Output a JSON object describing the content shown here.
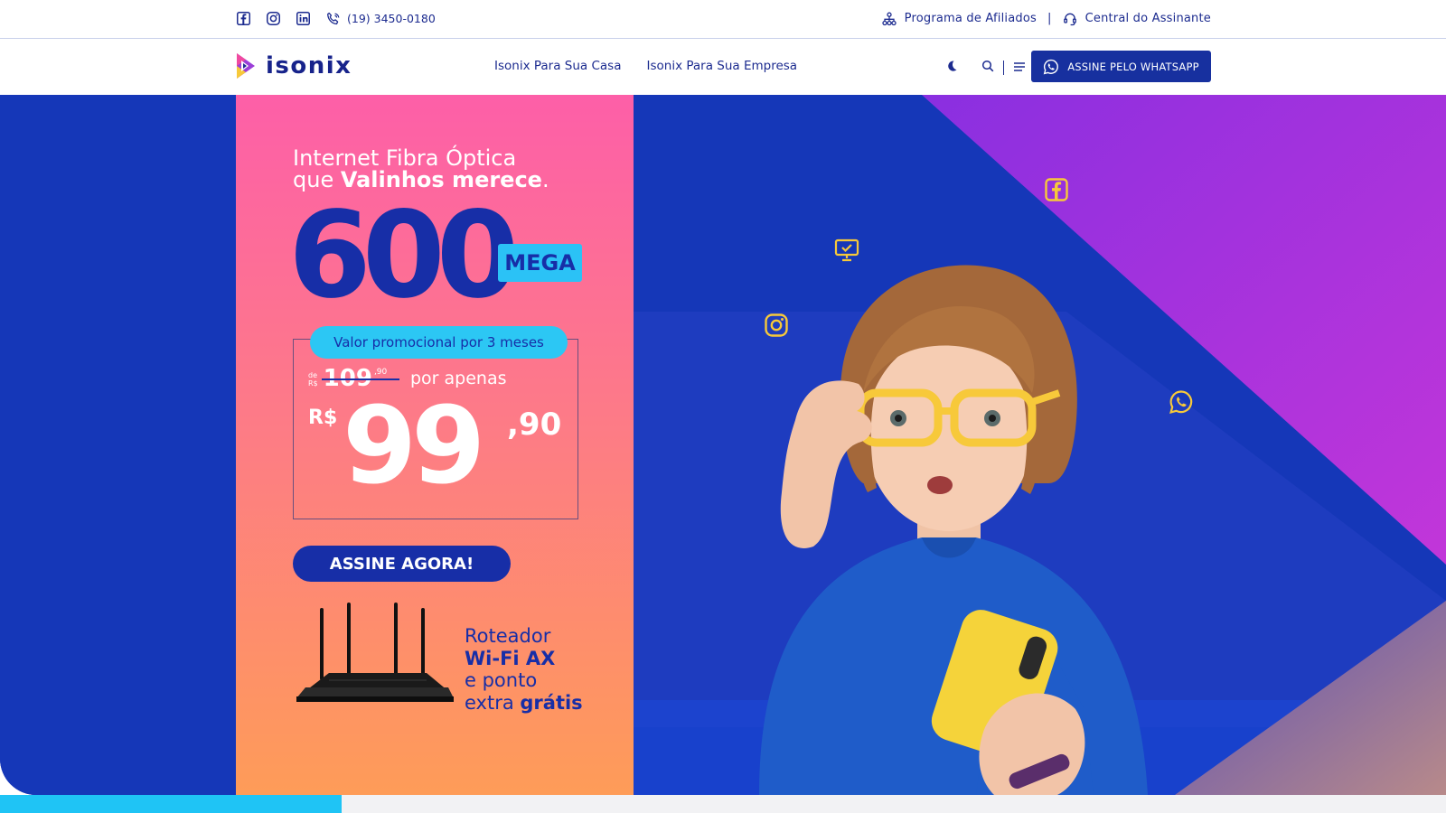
{
  "topbar": {
    "social_icons": [
      "facebook-icon",
      "instagram-icon",
      "linkedin-icon"
    ],
    "phone": "(19) 3450-0180",
    "affiliates": "Programa de Afiliados",
    "separator": "|",
    "subscriber": "Central do Assinante"
  },
  "nav": {
    "logo_text": "isonix",
    "links": [
      "Isonix Para Sua Casa",
      "Isonix Para Sua Empresa"
    ],
    "whatsapp_button": "ASSINE PELO WHATSAPP"
  },
  "hero": {
    "headline_line1": "Internet Fibra Óptica",
    "headline_line2_pre": "que ",
    "headline_line2_bold": "Valinhos merece",
    "headline_line2_post": ".",
    "speed": "600",
    "speed_unit": "MEGA",
    "promo_pill": "Valor promocional por 3 meses",
    "old_price_prefix_de": "de",
    "old_price_prefix_rs": "R$",
    "old_price": "109",
    "old_price_cents": ",90",
    "por_apenas": "por apenas",
    "currency": "R$",
    "price": "99",
    "price_cents": ",90",
    "cta": "ASSINE AGORA!",
    "router_line1": "Roteador",
    "router_line2": "Wi-Fi AX",
    "router_line3": "e ponto",
    "router_line4_pre": "extra ",
    "router_line4_bold": "grátis"
  },
  "colors": {
    "brand_blue": "#172ea7",
    "cyan": "#2cc7f4",
    "yellow": "#f7c93a",
    "pink": "#fd5fa8",
    "orange": "#fe9c58"
  }
}
